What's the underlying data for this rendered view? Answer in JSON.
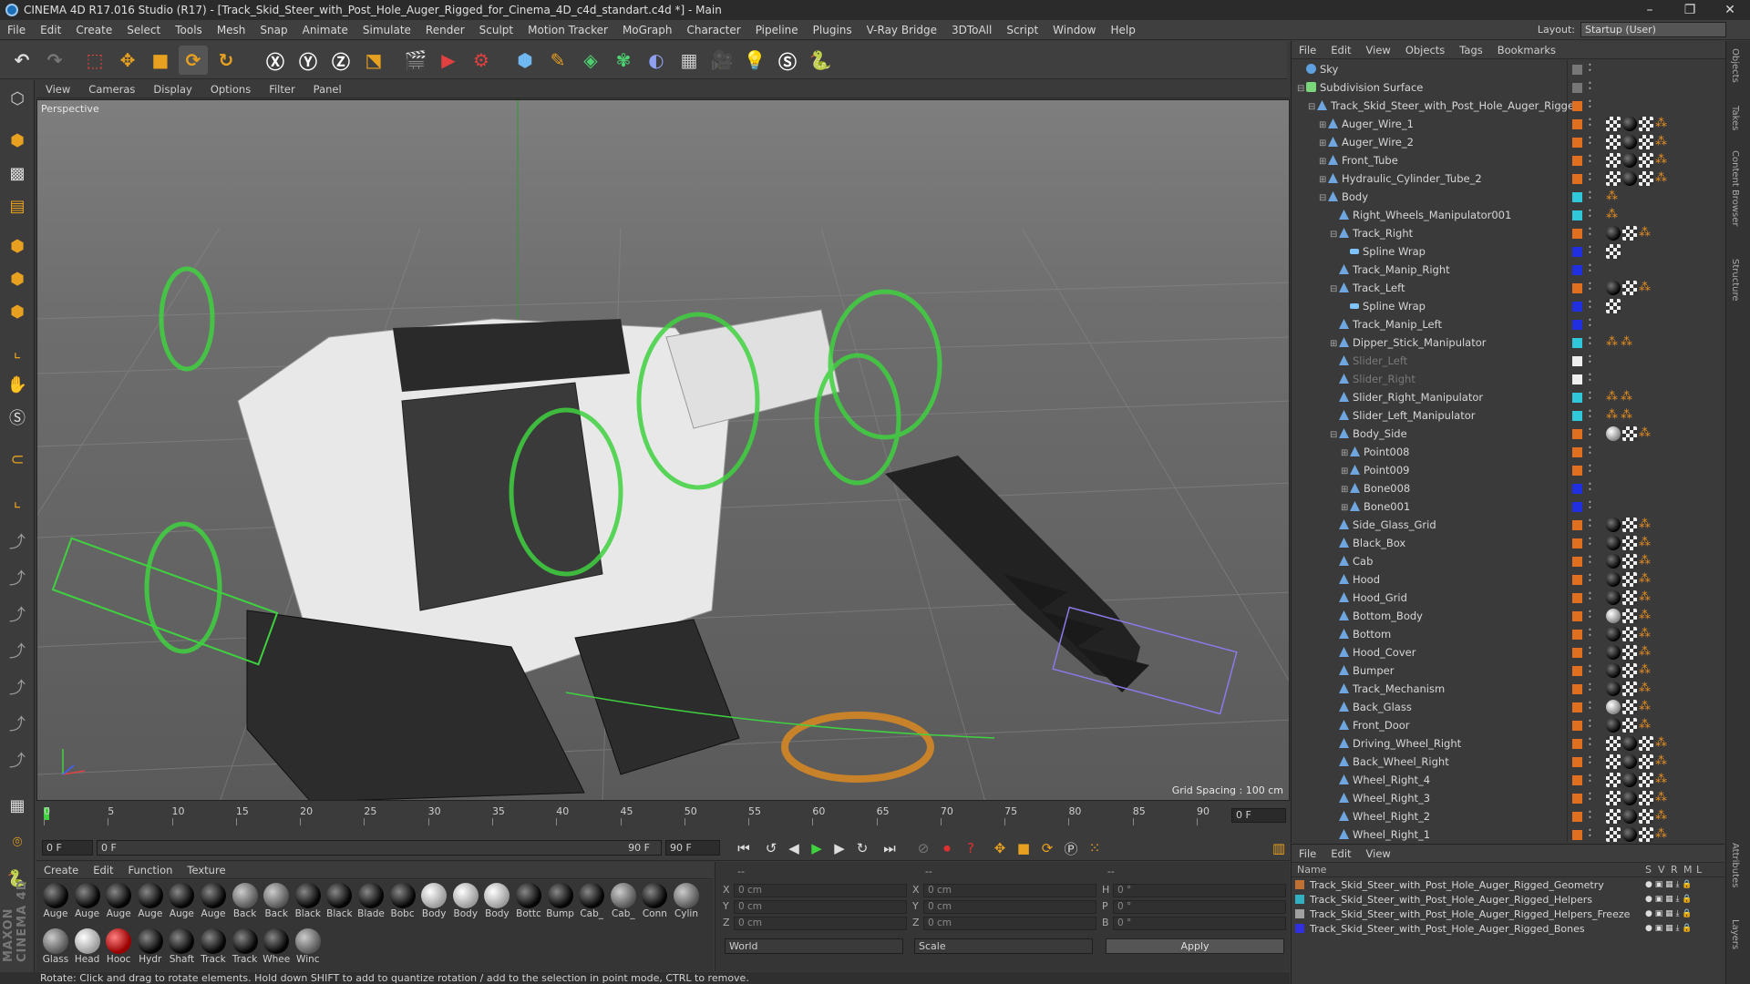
{
  "window": {
    "title": "CINEMA 4D R17.016 Studio (R17) - [Track_Skid_Steer_with_Post_Hole_Auger_Rigged_for_Cinema_4D_c4d_standart.c4d *] - Main"
  },
  "menubar": [
    "File",
    "Edit",
    "Create",
    "Select",
    "Tools",
    "Mesh",
    "Snap",
    "Animate",
    "Simulate",
    "Render",
    "Sculpt",
    "Motion Tracker",
    "MoGraph",
    "Character",
    "Pipeline",
    "Plugins",
    "V-Ray Bridge",
    "3DToAll",
    "Script",
    "Window",
    "Help"
  ],
  "layout": {
    "label": "Layout:",
    "value": "Startup (User)"
  },
  "viewport": {
    "menu": [
      "View",
      "Cameras",
      "Display",
      "Options",
      "Filter",
      "Panel"
    ],
    "camera": "Perspective",
    "grid_spacing": "Grid Spacing : 100 cm"
  },
  "timeline": {
    "ticks": [
      "0",
      "5",
      "10",
      "15",
      "20",
      "25",
      "30",
      "35",
      "40",
      "45",
      "50",
      "55",
      "60",
      "65",
      "70",
      "75",
      "80",
      "85",
      "90"
    ],
    "current_frame": "0 F",
    "start_field": "0 F",
    "range_start": "0 F",
    "range_end": "90 F",
    "end_field": "90 F"
  },
  "materials": {
    "menu": [
      "Create",
      "Edit",
      "Function",
      "Texture"
    ],
    "row1": [
      {
        "label": "Auge",
        "color": "black"
      },
      {
        "label": "Auge",
        "color": "black"
      },
      {
        "label": "Auge",
        "color": "black"
      },
      {
        "label": "Auge",
        "color": "black"
      },
      {
        "label": "Auge",
        "color": "black"
      },
      {
        "label": "Auge",
        "color": "black"
      },
      {
        "label": "Back",
        "color": "grey"
      },
      {
        "label": "Back",
        "color": "grey"
      },
      {
        "label": "Black",
        "color": "black"
      },
      {
        "label": "Black",
        "color": "black"
      },
      {
        "label": "Blade",
        "color": "black"
      },
      {
        "label": "Bobc",
        "color": "black"
      },
      {
        "label": "Body",
        "color": "white"
      },
      {
        "label": "Body",
        "color": "white"
      },
      {
        "label": "Body",
        "color": "white"
      },
      {
        "label": "Bottc",
        "color": "black"
      },
      {
        "label": "Bump",
        "color": "black"
      },
      {
        "label": "Cab_",
        "color": "black"
      },
      {
        "label": "Cab_",
        "color": "grey"
      },
      {
        "label": "Conn",
        "color": "black"
      },
      {
        "label": "Cylin",
        "color": "grey"
      }
    ],
    "row2": [
      {
        "label": "Glass",
        "color": "grey"
      },
      {
        "label": "Head",
        "color": "white"
      },
      {
        "label": "Hooc",
        "color": "red"
      },
      {
        "label": "Hydr",
        "color": "black"
      },
      {
        "label": "Shaft",
        "color": "black"
      },
      {
        "label": "Track",
        "color": "black"
      },
      {
        "label": "Track",
        "color": "black"
      },
      {
        "label": "Whee",
        "color": "black"
      },
      {
        "label": "Winc",
        "color": "grey"
      }
    ]
  },
  "coords": {
    "header": [
      "--",
      "--",
      "--"
    ],
    "rows": [
      {
        "a": "X",
        "av": "0 cm",
        "b": "X",
        "bv": "0 cm",
        "c": "H",
        "cv": "0 °"
      },
      {
        "a": "Y",
        "av": "0 cm",
        "b": "Y",
        "bv": "0 cm",
        "c": "P",
        "cv": "0 °"
      },
      {
        "a": "Z",
        "av": "0 cm",
        "b": "Z",
        "bv": "0 cm",
        "c": "B",
        "cv": "0 °"
      }
    ],
    "world": "World",
    "scale": "Scale",
    "apply": "Apply"
  },
  "status": "Rotate: Click and drag to rotate elements. Hold down SHIFT to add to quantize rotation / add to the selection in point mode, CTRL to remove.",
  "objects": {
    "menu": [
      "File",
      "Edit",
      "View",
      "Objects",
      "Tags",
      "Bookmarks"
    ],
    "rows": [
      {
        "name": "Sky",
        "depth": 0,
        "icon": "sky",
        "exp": "",
        "vis": "#777",
        "dim": false,
        "tags": []
      },
      {
        "name": "Subdivision Surface",
        "depth": 0,
        "icon": "sub",
        "exp": "⊟",
        "vis": "#777",
        "dim": false,
        "tags": []
      },
      {
        "name": "Track_Skid_Steer_with_Post_Hole_Auger_Rigged",
        "depth": 1,
        "icon": "null",
        "exp": "⊟",
        "vis": "#e07020",
        "dim": false,
        "tags": []
      },
      {
        "name": "Auger_Wire_1",
        "depth": 2,
        "icon": "obj",
        "exp": "⊞",
        "vis": "#e07020",
        "dim": false,
        "tags": [
          "chk",
          "blk",
          "chk",
          "org"
        ]
      },
      {
        "name": "Auger_Wire_2",
        "depth": 2,
        "icon": "obj",
        "exp": "⊞",
        "vis": "#e07020",
        "dim": false,
        "tags": [
          "chk",
          "blk",
          "chk",
          "org"
        ]
      },
      {
        "name": "Front_Tube",
        "depth": 2,
        "icon": "obj",
        "exp": "⊞",
        "vis": "#e07020",
        "dim": false,
        "tags": [
          "chk",
          "blk",
          "chk",
          "org"
        ]
      },
      {
        "name": "Hydraulic_Cylinder_Tube_2",
        "depth": 2,
        "icon": "obj",
        "exp": "⊞",
        "vis": "#e07020",
        "dim": false,
        "tags": [
          "chk",
          "blk",
          "chk",
          "org"
        ]
      },
      {
        "name": "Body",
        "depth": 2,
        "icon": "obj",
        "exp": "⊟",
        "vis": "#30c8d8",
        "dim": false,
        "tags": [
          "org"
        ]
      },
      {
        "name": "Right_Wheels_Manipulator001",
        "depth": 3,
        "icon": "obj",
        "exp": "",
        "vis": "#30c8d8",
        "dim": false,
        "tags": [
          "org"
        ]
      },
      {
        "name": "Track_Right",
        "depth": 3,
        "icon": "obj",
        "exp": "⊟",
        "vis": "#e07020",
        "dim": false,
        "tags": [
          "blk",
          "chk",
          "org"
        ]
      },
      {
        "name": "Spline Wrap",
        "depth": 4,
        "icon": "sp",
        "exp": "",
        "vis": "#2030e0",
        "dim": false,
        "tags": [
          "chk"
        ]
      },
      {
        "name": "Track_Manip_Right",
        "depth": 3,
        "icon": "obj",
        "exp": "",
        "vis": "#2030e0",
        "dim": false,
        "tags": []
      },
      {
        "name": "Track_Left",
        "depth": 3,
        "icon": "obj",
        "exp": "⊟",
        "vis": "#e07020",
        "dim": false,
        "tags": [
          "blk",
          "chk",
          "org"
        ]
      },
      {
        "name": "Spline Wrap",
        "depth": 4,
        "icon": "sp",
        "exp": "",
        "vis": "#2030e0",
        "dim": false,
        "tags": [
          "chk"
        ]
      },
      {
        "name": "Track_Manip_Left",
        "depth": 3,
        "icon": "obj",
        "exp": "",
        "vis": "#2030e0",
        "dim": false,
        "tags": []
      },
      {
        "name": "Dipper_Stick_Manipulator",
        "depth": 3,
        "icon": "obj",
        "exp": "⊞",
        "vis": "#30c8d8",
        "dim": false,
        "tags": [
          "org",
          "org"
        ]
      },
      {
        "name": "Slider_Left",
        "depth": 3,
        "icon": "obj",
        "exp": "",
        "vis": "#eee",
        "dim": true,
        "tags": []
      },
      {
        "name": "Slider_Right",
        "depth": 3,
        "icon": "obj",
        "exp": "",
        "vis": "#eee",
        "dim": true,
        "tags": []
      },
      {
        "name": "Slider_Right_Manipulator",
        "depth": 3,
        "icon": "obj",
        "exp": "",
        "vis": "#30c8d8",
        "dim": false,
        "tags": [
          "org",
          "org"
        ]
      },
      {
        "name": "Slider_Left_Manipulator",
        "depth": 3,
        "icon": "obj",
        "exp": "",
        "vis": "#30c8d8",
        "dim": false,
        "tags": [
          "org",
          "org"
        ]
      },
      {
        "name": "Body_Side",
        "depth": 3,
        "icon": "obj",
        "exp": "⊟",
        "vis": "#e07020",
        "dim": false,
        "tags": [
          "wht",
          "chk",
          "org"
        ]
      },
      {
        "name": "Point008",
        "depth": 4,
        "icon": "null",
        "exp": "⊞",
        "vis": "#e07020",
        "dim": false,
        "tags": []
      },
      {
        "name": "Point009",
        "depth": 4,
        "icon": "null",
        "exp": "⊞",
        "vis": "#e07020",
        "dim": false,
        "tags": []
      },
      {
        "name": "Bone008",
        "depth": 4,
        "icon": "bone",
        "exp": "⊞",
        "vis": "#2030e0",
        "dim": false,
        "tags": []
      },
      {
        "name": "Bone001",
        "depth": 4,
        "icon": "bone",
        "exp": "⊞",
        "vis": "#2030e0",
        "dim": false,
        "tags": []
      },
      {
        "name": "Side_Glass_Grid",
        "depth": 3,
        "icon": "obj",
        "exp": "",
        "vis": "#e07020",
        "dim": false,
        "tags": [
          "blk",
          "chk",
          "org"
        ]
      },
      {
        "name": "Black_Box",
        "depth": 3,
        "icon": "obj",
        "exp": "",
        "vis": "#e07020",
        "dim": false,
        "tags": [
          "blk",
          "chk",
          "org"
        ]
      },
      {
        "name": "Cab",
        "depth": 3,
        "icon": "obj",
        "exp": "",
        "vis": "#e07020",
        "dim": false,
        "tags": [
          "blk",
          "chk",
          "org"
        ]
      },
      {
        "name": "Hood",
        "depth": 3,
        "icon": "obj",
        "exp": "",
        "vis": "#e07020",
        "dim": false,
        "tags": [
          "blk",
          "chk",
          "org"
        ]
      },
      {
        "name": "Hood_Grid",
        "depth": 3,
        "icon": "obj",
        "exp": "",
        "vis": "#e07020",
        "dim": false,
        "tags": [
          "blk",
          "chk",
          "org"
        ]
      },
      {
        "name": "Bottom_Body",
        "depth": 3,
        "icon": "obj",
        "exp": "",
        "vis": "#e07020",
        "dim": false,
        "tags": [
          "wht",
          "chk",
          "org"
        ]
      },
      {
        "name": "Bottom",
        "depth": 3,
        "icon": "obj",
        "exp": "",
        "vis": "#e07020",
        "dim": false,
        "tags": [
          "blk",
          "chk",
          "org"
        ]
      },
      {
        "name": "Hood_Cover",
        "depth": 3,
        "icon": "obj",
        "exp": "",
        "vis": "#e07020",
        "dim": false,
        "tags": [
          "blk",
          "chk",
          "org"
        ]
      },
      {
        "name": "Bumper",
        "depth": 3,
        "icon": "obj",
        "exp": "",
        "vis": "#e07020",
        "dim": false,
        "tags": [
          "blk",
          "chk",
          "org"
        ]
      },
      {
        "name": "Track_Mechanism",
        "depth": 3,
        "icon": "obj",
        "exp": "",
        "vis": "#e07020",
        "dim": false,
        "tags": [
          "blk",
          "chk",
          "org"
        ]
      },
      {
        "name": "Back_Glass",
        "depth": 3,
        "icon": "obj",
        "exp": "",
        "vis": "#e07020",
        "dim": false,
        "tags": [
          "wht",
          "chk",
          "org"
        ]
      },
      {
        "name": "Front_Door",
        "depth": 3,
        "icon": "obj",
        "exp": "",
        "vis": "#e07020",
        "dim": false,
        "tags": [
          "blk",
          "chk",
          "org"
        ]
      },
      {
        "name": "Driving_Wheel_Right",
        "depth": 3,
        "icon": "obj",
        "exp": "",
        "vis": "#e07020",
        "dim": false,
        "tags": [
          "chk",
          "blk",
          "chk",
          "org"
        ]
      },
      {
        "name": "Back_Wheel_Right",
        "depth": 3,
        "icon": "obj",
        "exp": "",
        "vis": "#e07020",
        "dim": false,
        "tags": [
          "chk",
          "blk",
          "chk",
          "org"
        ]
      },
      {
        "name": "Wheel_Right_4",
        "depth": 3,
        "icon": "obj",
        "exp": "",
        "vis": "#e07020",
        "dim": false,
        "tags": [
          "chk",
          "blk",
          "chk",
          "org"
        ]
      },
      {
        "name": "Wheel_Right_3",
        "depth": 3,
        "icon": "obj",
        "exp": "",
        "vis": "#e07020",
        "dim": false,
        "tags": [
          "chk",
          "blk",
          "chk",
          "org"
        ]
      },
      {
        "name": "Wheel_Right_2",
        "depth": 3,
        "icon": "obj",
        "exp": "",
        "vis": "#e07020",
        "dim": false,
        "tags": [
          "chk",
          "blk",
          "chk",
          "org"
        ]
      },
      {
        "name": "Wheel_Right_1",
        "depth": 3,
        "icon": "obj",
        "exp": "",
        "vis": "#e07020",
        "dim": false,
        "tags": [
          "chk",
          "blk",
          "chk",
          "org"
        ]
      }
    ]
  },
  "layers": {
    "menu": [
      "File",
      "Edit",
      "View"
    ],
    "header": {
      "name": "Name",
      "cols": [
        "S",
        "V",
        "R",
        "M",
        "L"
      ]
    },
    "rows": [
      {
        "name": "Track_Skid_Steer_with_Post_Hole_Auger_Rigged_Geometry",
        "color": "#c07030"
      },
      {
        "name": "Track_Skid_Steer_with_Post_Hole_Auger_Rigged_Helpers",
        "color": "#30b0c0"
      },
      {
        "name": "Track_Skid_Steer_with_Post_Hole_Auger_Rigged_Helpers_Freeze",
        "color": "#a0a0a0"
      },
      {
        "name": "Track_Skid_Steer_with_Post_Hole_Auger_Rigged_Bones",
        "color": "#3030e0"
      }
    ]
  },
  "side_tabs": [
    "Objects",
    "Takes",
    "Content Browser",
    "Structure",
    "Attributes",
    "Layers"
  ]
}
